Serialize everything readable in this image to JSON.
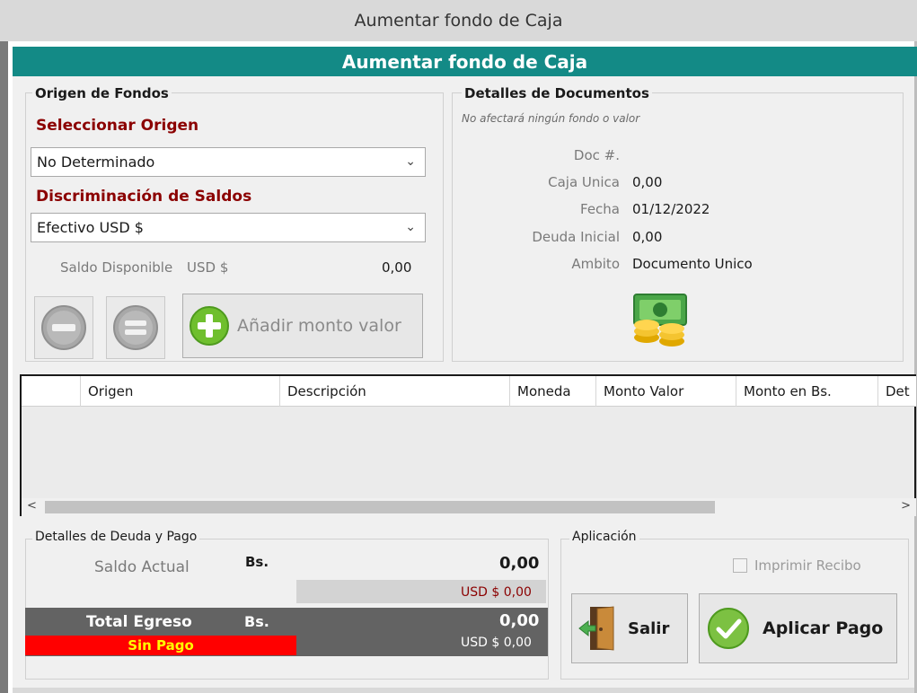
{
  "window": {
    "title": "Aumentar fondo de Caja"
  },
  "header": {
    "title": "Aumentar fondo de Caja"
  },
  "origen": {
    "legend": "Origen de Fondos",
    "select_label": "Seleccionar Origen",
    "select_value": "No Determinado",
    "discrim_label": "Discriminación de Saldos",
    "discrim_value": "Efectivo USD $",
    "saldo_label": "Saldo Disponible",
    "saldo_currency": "USD $",
    "saldo_value": "0,00",
    "add_button": "Añadir monto valor"
  },
  "detalles": {
    "legend": "Detalles de Documentos",
    "note": "No afectará ningún fondo o valor",
    "fields": [
      {
        "label": "Doc #.",
        "value": ""
      },
      {
        "label": "Caja Unica",
        "value": "0,00"
      },
      {
        "label": "Fecha",
        "value": "01/12/2022"
      },
      {
        "label": "Deuda Inicial",
        "value": "0,00"
      },
      {
        "label": "Ambito",
        "value": "Documento Unico"
      }
    ]
  },
  "grid": {
    "columns": [
      "Origen",
      "Descripción",
      "Moneda",
      "Monto Valor",
      "Monto en Bs.",
      "Det"
    ]
  },
  "deuda": {
    "legend": "Detalles de Deuda y Pago",
    "saldo_label": "Saldo Actual",
    "currency_bs": "Bs.",
    "saldo_value": "0,00",
    "saldo_usd": "USD $ 0,00",
    "total_label": "Total Egreso",
    "total_currency": "Bs.",
    "total_value": "0,00",
    "total_usd": "USD $ 0,00",
    "status": "Sin Pago"
  },
  "aplicacion": {
    "legend": "Aplicación",
    "imprimir": "Imprimir Recibo",
    "salir": "Salir",
    "aplicar": "Aplicar Pago"
  },
  "colors": {
    "header": "#138a86",
    "label_red": "#8b0000",
    "status_red": "#ff0000",
    "status_text": "#ffff00",
    "total_bar": "#636363"
  }
}
